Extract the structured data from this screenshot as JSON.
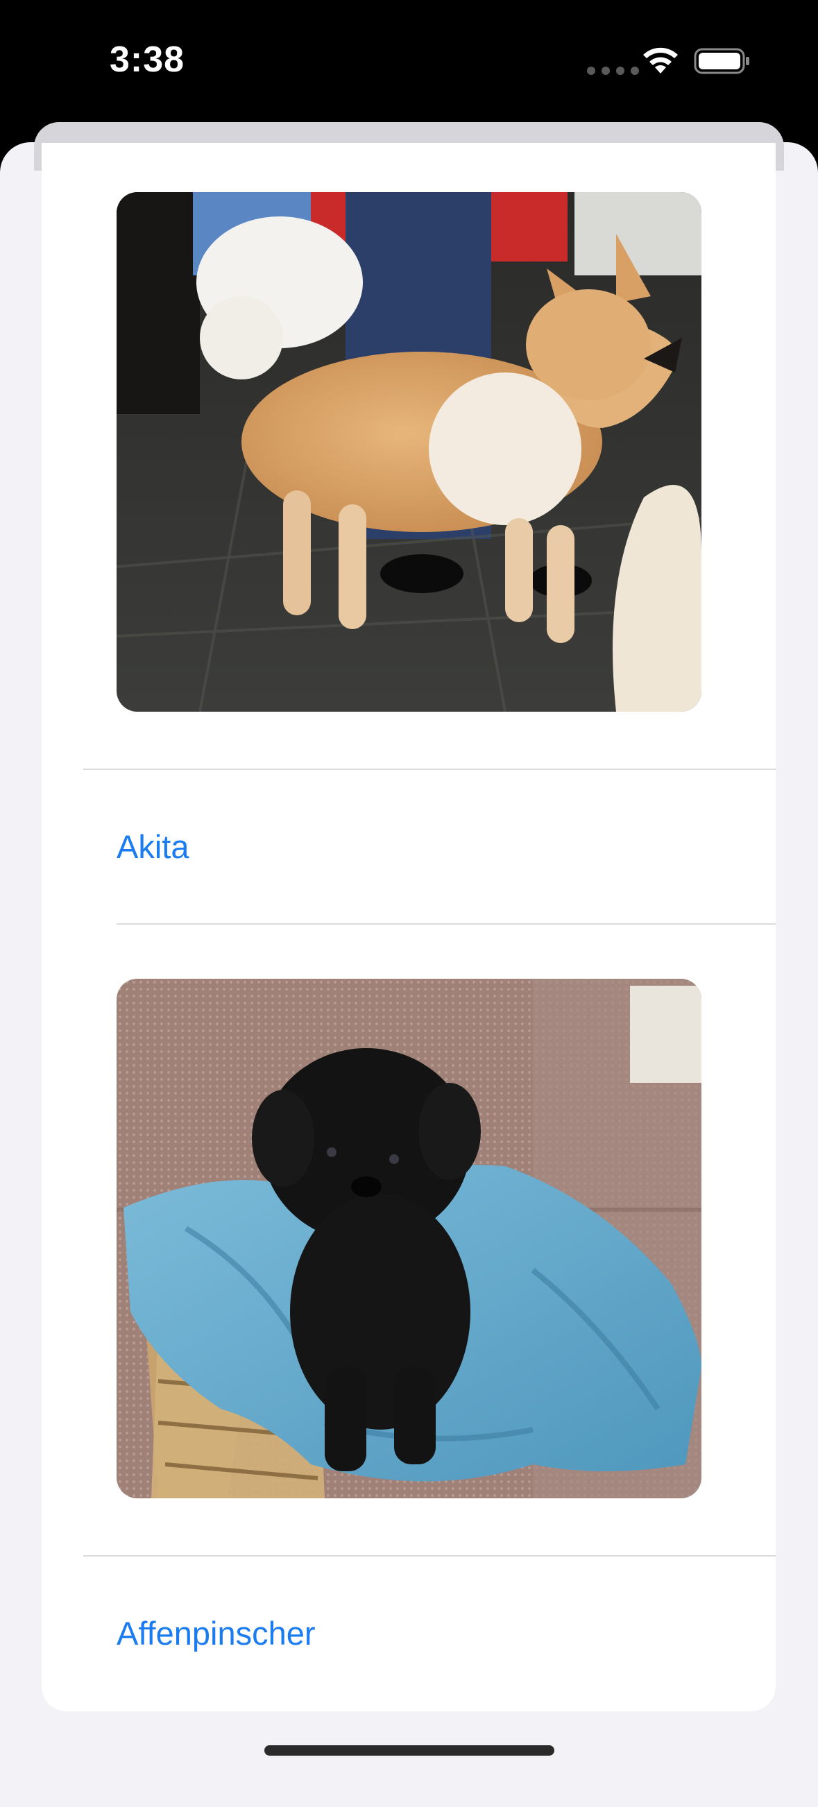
{
  "status_bar": {
    "time": "3:38",
    "icons": [
      "signal-dots-icon",
      "wifi-icon",
      "battery-icon"
    ]
  },
  "colors": {
    "link": "#1a7cf0",
    "sheet_background": "#f2f2f7",
    "separator": "#dcdce0"
  },
  "breeds": [
    {
      "name": "Akita",
      "photo": "akita-dog-photo"
    },
    {
      "name": "Affenpinscher",
      "photo": "affenpinscher-dog-photo"
    }
  ]
}
